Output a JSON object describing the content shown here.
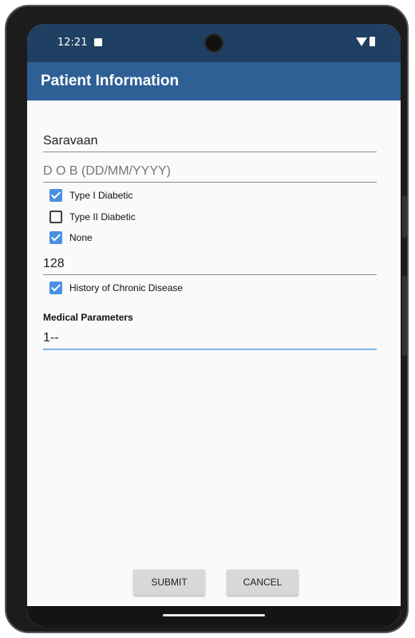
{
  "status_bar": {
    "time": "12:21",
    "icons": [
      "notification-icon",
      "camera-cutout",
      "wifi-icon",
      "battery-icon"
    ]
  },
  "app_bar": {
    "title": "Patient Information",
    "color": "#2e6096"
  },
  "form": {
    "name_field": {
      "value": "Saravaan",
      "placeholder": ""
    },
    "dob_field": {
      "value": "",
      "placeholder": "D O B (DD/MM/YYYY)"
    },
    "checkboxes": [
      {
        "label": "Type I Diabetic",
        "checked": true
      },
      {
        "label": "Type II Diabetic",
        "checked": false
      },
      {
        "label": "None",
        "checked": true
      }
    ],
    "number_field": {
      "value": "128"
    },
    "chronic_checkbox": {
      "label": "History of Chronic Disease",
      "checked": true
    },
    "section_title": "Medical Parameters",
    "parameters_field": {
      "value": "1--"
    }
  },
  "buttons": {
    "submit": "SUBMIT",
    "cancel": "CANCEL"
  },
  "colors": {
    "accent": "#4a90e2",
    "status_bar": "#1f3f63"
  }
}
